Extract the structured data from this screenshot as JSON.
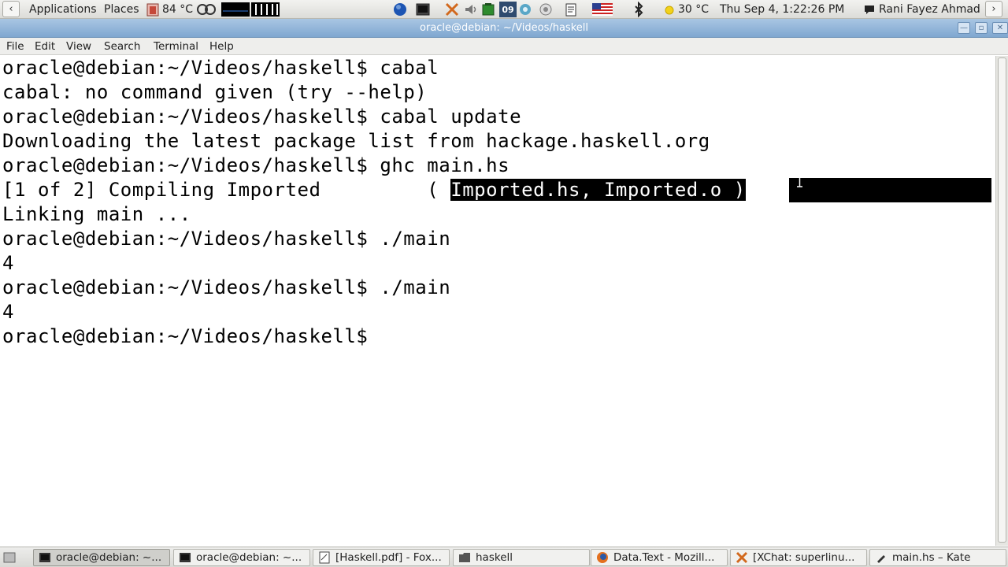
{
  "top_panel": {
    "applications": "Applications",
    "places": "Places",
    "temp_cpu": "84 °C",
    "weather_temp": "30 °C",
    "clock": "Thu Sep  4,  1:22:26 PM",
    "user": "Rani Fayez Ahmad",
    "calendar_day": "09"
  },
  "window": {
    "title": "oracle@debian: ~/Videos/haskell"
  },
  "menu": [
    "File",
    "Edit",
    "View",
    "Search",
    "Terminal",
    "Help"
  ],
  "terminal": {
    "lines": [
      "oracle@debian:~/Videos/haskell$ cabal",
      "cabal: no command given (try --help)",
      "oracle@debian:~/Videos/haskell$ cabal update",
      "Downloading the latest package list from hackage.haskell.org",
      "oracle@debian:~/Videos/haskell$ ghc main.hs",
      "[1 of 2] Compiling Imported         ( ",
      "Linking main ...",
      "oracle@debian:~/Videos/haskell$ ./main",
      "4",
      "oracle@debian:~/Videos/haskell$ ./main",
      "4",
      "oracle@debian:~/Videos/haskell$ "
    ],
    "selected_text": "Imported.hs, Imported.o )"
  },
  "taskbar": [
    {
      "label": "oracle@debian: ~...",
      "icon": "terminal-icon",
      "active": true
    },
    {
      "label": "oracle@debian: ~...",
      "icon": "terminal-icon",
      "active": false
    },
    {
      "label": "[Haskell.pdf] - Fox...",
      "icon": "document-icon",
      "active": false
    },
    {
      "label": "haskell",
      "icon": "folder-icon",
      "active": false
    },
    {
      "label": "Data.Text - Mozill...",
      "icon": "firefox-icon",
      "active": false
    },
    {
      "label": "[XChat: superlinu...",
      "icon": "xchat-icon",
      "active": false
    },
    {
      "label": "main.hs – Kate",
      "icon": "kate-icon",
      "active": false
    }
  ]
}
